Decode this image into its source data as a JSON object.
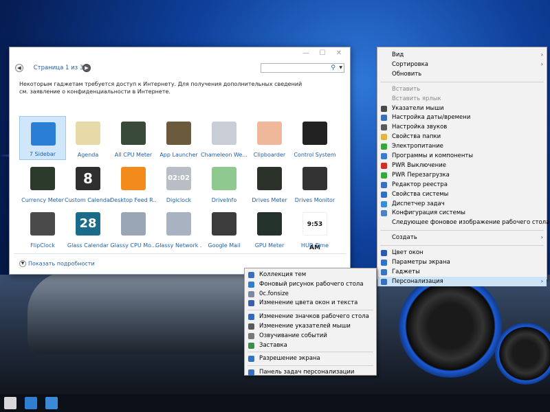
{
  "gadget_window": {
    "page_info": "Страница 1 из 3",
    "notice": "Некоторым гаджетам требуется доступ к Интернету. Для получения дополнительных сведений см. заявление о конфиденциальности в Интернете.",
    "show_details": "Показать подробности",
    "gadgets": [
      {
        "label": "7 Sidebar",
        "icon": "sidebar-icon",
        "color": "#2a7fd4"
      },
      {
        "label": "Agenda",
        "icon": "calendar-icon",
        "color": "#e7d9a8"
      },
      {
        "label": "All CPU Meter",
        "icon": "cpu-meter-icon",
        "color": "#3a4a3a"
      },
      {
        "label": "App Launcher",
        "icon": "launcher-icon",
        "color": "#6b5a3c"
      },
      {
        "label": "Chameleon We...",
        "icon": "weather-icon",
        "color": "#c9ced6"
      },
      {
        "label": "Clipboarder",
        "icon": "clipboard-icon",
        "color": "#f0b89a"
      },
      {
        "label": "Control System",
        "icon": "control-icon",
        "color": "#222"
      },
      {
        "label": "Currency Meter",
        "icon": "currency-icon",
        "color": "#2b3a2b"
      },
      {
        "label": "Custom Calendar",
        "icon": "calendar-8-icon",
        "color": "#2f2f2f"
      },
      {
        "label": "Desktop Feed R...",
        "icon": "rss-icon",
        "color": "#f28a1c"
      },
      {
        "label": "Digiclock",
        "icon": "digital-clock-icon",
        "color": "#b9bec6"
      },
      {
        "label": "DriveInfo",
        "icon": "drive-icon",
        "color": "#8fc98f"
      },
      {
        "label": "Drives Meter",
        "icon": "drives-meter-icon",
        "color": "#2a322a"
      },
      {
        "label": "Drives Monitor",
        "icon": "drives-monitor-icon",
        "color": "#333"
      },
      {
        "label": "FlipClock",
        "icon": "flip-clock-icon",
        "color": "#4a4a4a"
      },
      {
        "label": "Glass Calendar",
        "icon": "glass-calendar-icon",
        "color": "#1a6a8a"
      },
      {
        "label": "Glassy CPU Mo...",
        "icon": "glassy-cpu-icon",
        "color": "#9aa6b6"
      },
      {
        "label": "Glassy Network ...",
        "icon": "glassy-network-icon",
        "color": "#a8b2c0"
      },
      {
        "label": "Google Mail",
        "icon": "mail-icon",
        "color": "#3c3c3c"
      },
      {
        "label": "GPU Meter",
        "icon": "gpu-meter-icon",
        "color": "#23322a"
      },
      {
        "label": "HUD Time",
        "icon": "hud-time-icon",
        "color": "#ffffff"
      }
    ],
    "tile_texts": {
      "custom_calendar_day": "8",
      "glass_calendar_day": "28",
      "digiclock_time": "02:02",
      "hud_time": "9:53 AM"
    }
  },
  "context_menu": {
    "items": [
      {
        "label": "Вид",
        "submenu": true
      },
      {
        "label": "Сортировка",
        "submenu": true
      },
      {
        "label": "Обновить"
      },
      {
        "sep": true
      },
      {
        "label": "Вставить",
        "disabled": true
      },
      {
        "label": "Вставить ярлык",
        "disabled": true
      },
      {
        "label": "Указатели мыши",
        "icon": "mouse-pointer-icon",
        "color": "#4a4a4a"
      },
      {
        "label": "Настройка даты/времени",
        "icon": "clock-icon",
        "color": "#3a6fb6"
      },
      {
        "label": "Настройка звуков",
        "icon": "speaker-icon",
        "color": "#5a5a5a"
      },
      {
        "label": "Свойства папки",
        "icon": "folder-icon",
        "color": "#e2b440"
      },
      {
        "label": "Электропитание",
        "icon": "power-plan-icon",
        "color": "#3aa53a"
      },
      {
        "label": "Программы и компоненты",
        "icon": "programs-icon",
        "color": "#3d7bd1"
      },
      {
        "label": "PWR Выключение",
        "icon": "shutdown-icon",
        "color": "#d42b2b"
      },
      {
        "label": "PWR Перезагрузка",
        "icon": "restart-icon",
        "color": "#38a838"
      },
      {
        "label": "Редактор реестра",
        "icon": "registry-icon",
        "color": "#3c6fc4"
      },
      {
        "label": "Свойства системы",
        "icon": "system-icon",
        "color": "#2f6ec2"
      },
      {
        "label": "Диспетчер задач",
        "icon": "task-manager-icon",
        "color": "#3a8cd6"
      },
      {
        "label": "Конфигурация системы",
        "icon": "config-icon",
        "color": "#4f7fc4"
      },
      {
        "label": "Следующее фоновое изображение рабочего стола"
      },
      {
        "sep": true
      },
      {
        "label": "Создать",
        "submenu": true
      },
      {
        "sep": true
      },
      {
        "label": "Цвет окон",
        "icon": "window-color-icon",
        "color": "#2a5ab4"
      },
      {
        "label": "Параметры экрана",
        "icon": "display-icon",
        "color": "#2f74c8"
      },
      {
        "label": "Гаджеты",
        "icon": "gadgets-icon",
        "color": "#3a73c0"
      },
      {
        "label": "Персонализация",
        "icon": "personalize-icon",
        "color": "#3a6fc0",
        "submenu": true,
        "highlighted": true
      }
    ]
  },
  "sub_menu": {
    "items": [
      {
        "label": "Коллекция тем",
        "icon": "themes-icon",
        "color": "#3a6fc0"
      },
      {
        "label": "Фоновый рисунок рабочего стола",
        "icon": "wallpaper-icon",
        "color": "#2f7fd0"
      },
      {
        "label": "0c.fonsize",
        "icon": "file-icon",
        "color": "#7a8aa0"
      },
      {
        "label": "Изменение цвета окон и текста",
        "icon": "color-icon",
        "color": "#3a5fb0"
      },
      {
        "sep": true
      },
      {
        "label": "Изменение значков рабочего стола",
        "icon": "desktop-icons-icon",
        "color": "#2d6bbf"
      },
      {
        "label": "Изменение указателей мыши",
        "icon": "mouse-icon",
        "color": "#5a5a5a"
      },
      {
        "label": "Озвучивание событий",
        "icon": "sound-icon",
        "color": "#777"
      },
      {
        "label": "Заставка",
        "icon": "screensaver-icon",
        "color": "#3c8f4a"
      },
      {
        "sep": true
      },
      {
        "label": "Разрешение экрана",
        "icon": "resolution-icon",
        "color": "#2f74c8"
      },
      {
        "sep": true
      },
      {
        "label": "Панель задач персонализации",
        "icon": "taskbar-icon",
        "color": "#3a6fc0"
      }
    ]
  },
  "taskbar": {
    "items": [
      {
        "icon": "store-icon",
        "color": "#d8d8d8"
      },
      {
        "icon": "window-icon",
        "color": "#2f7fd0"
      },
      {
        "icon": "computer-icon",
        "color": "#3a8ad8"
      }
    ]
  }
}
